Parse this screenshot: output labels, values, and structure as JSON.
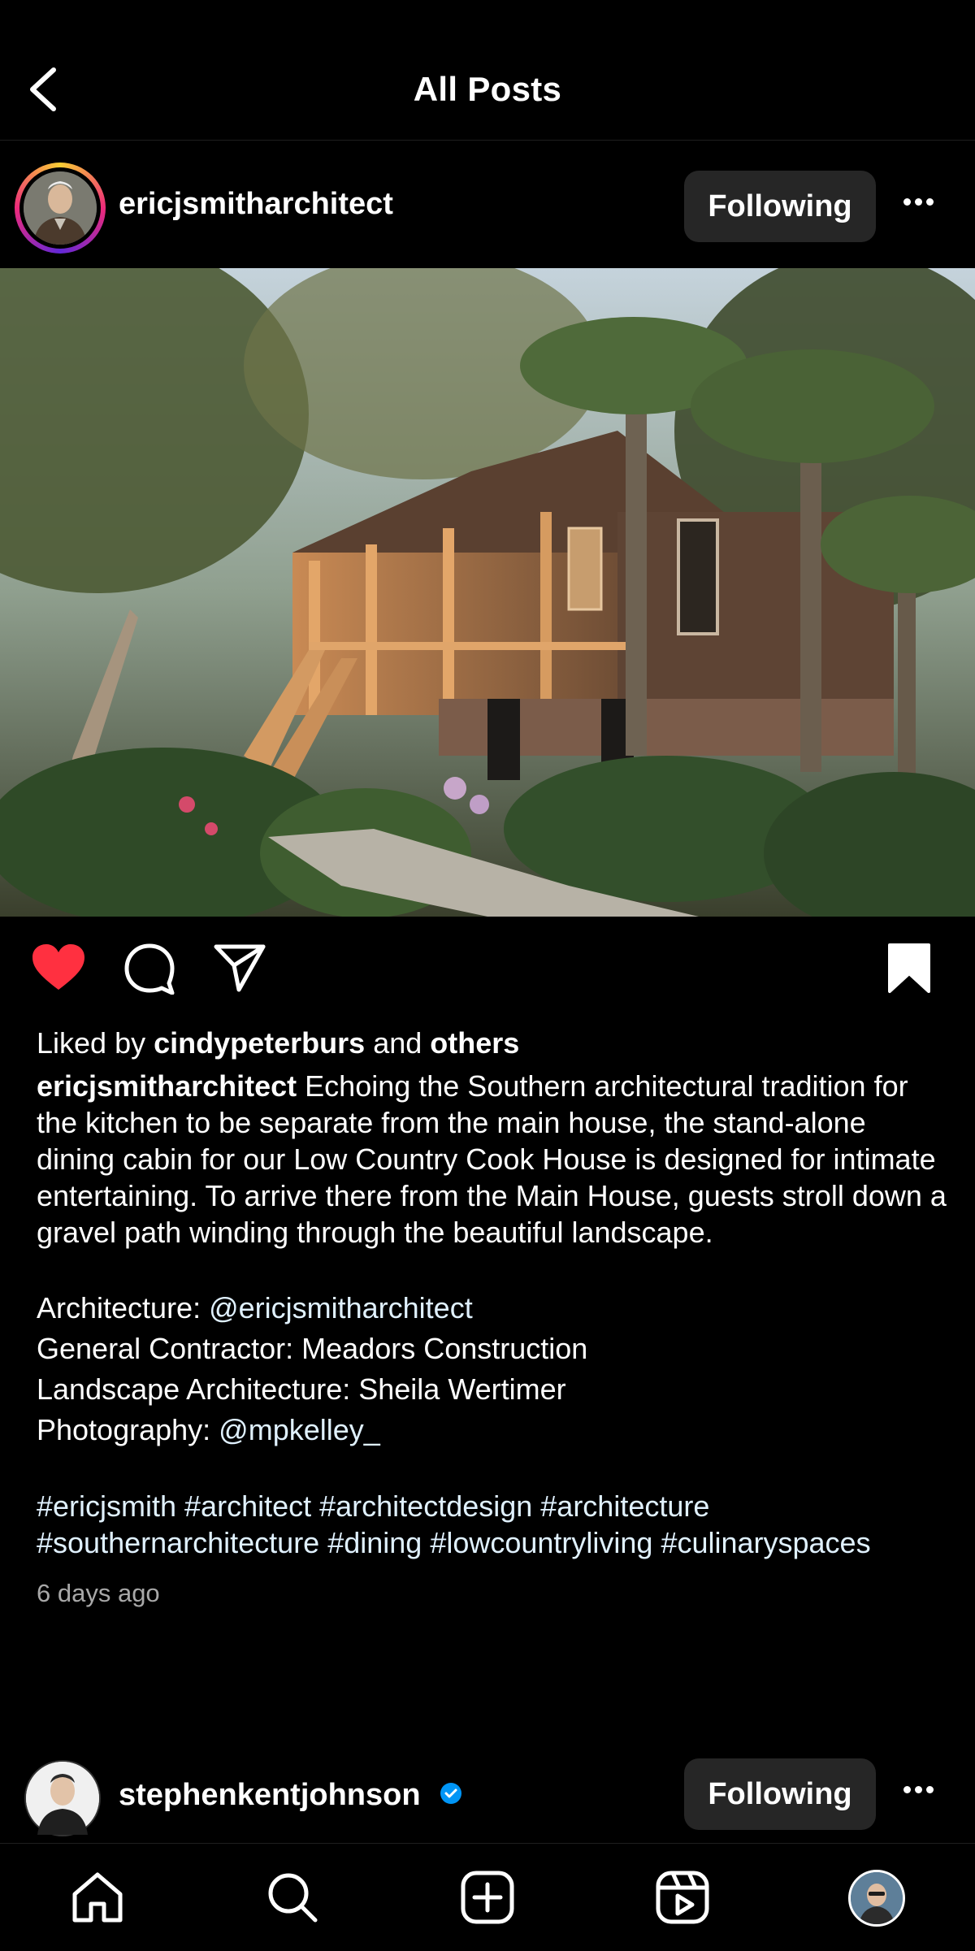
{
  "header": {
    "title": "All Posts"
  },
  "post": {
    "username": "ericjsmitharchitect",
    "follow_label": "Following",
    "liked_by_prefix": "Liked by",
    "liked_by_user": "cindypeterburs",
    "liked_by_and": "and",
    "liked_by_others": "others",
    "caption_user": "ericjsmitharchitect",
    "caption_text": "Echoing the Southern architectural tradition for the kitchen to be separate from the main house, the stand-alone dining cabin for our Low Country Cook House is designed for intimate entertaining. To arrive there from the Main House, guests stroll down a gravel path winding through the beautiful landscape.",
    "credits": [
      {
        "label": "Architecture: ",
        "value": "@ericjsmitharchitect",
        "is_mention": true
      },
      {
        "label": "General Contractor: ",
        "value": "Meadors Construction",
        "is_mention": false
      },
      {
        "label": "Landscape Architecture: ",
        "value": "Sheila Wertimer",
        "is_mention": false
      },
      {
        "label": "Photography: ",
        "value": "@mpkelley_",
        "is_mention": true
      }
    ],
    "hashtags": "#ericjsmith #architect #architectdesign #architecture #southernarchitecture #dining #lowcountryliving #culinaryspaces",
    "time_ago": "6 days ago",
    "liked": true,
    "saved": true
  },
  "next_post": {
    "username": "stephenkentjohnson",
    "follow_label": "Following",
    "verified": true
  },
  "tabbar": {
    "items": [
      "home-icon",
      "search-icon",
      "create-icon",
      "reels-icon",
      "profile-avatar"
    ]
  },
  "colors": {
    "like": "#ff3040",
    "verified": "#0095f6",
    "button_bg": "#262626",
    "secondary_text": "#a8a8a8"
  }
}
